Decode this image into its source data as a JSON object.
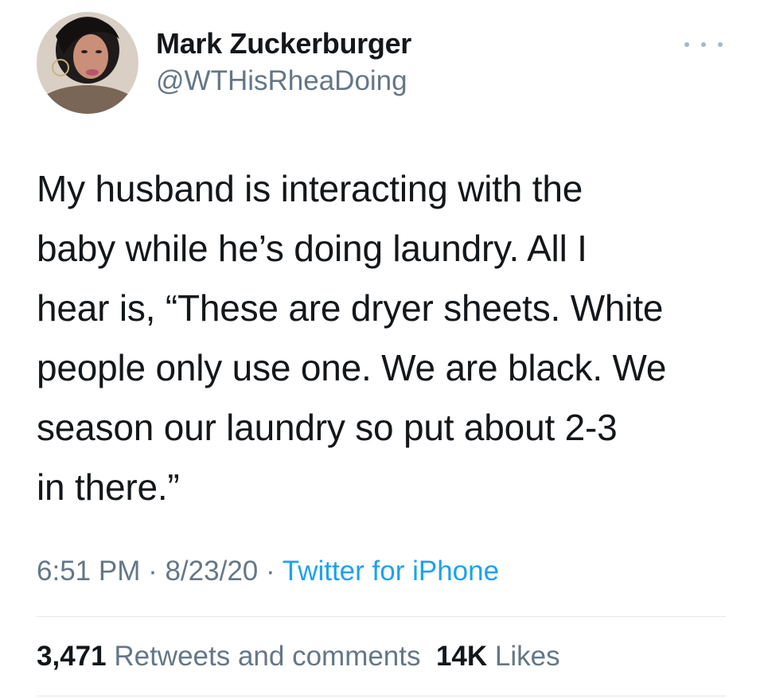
{
  "author": {
    "name": "Mark Zuckerburger",
    "handle": "@WTHisRheaDoing"
  },
  "tweet": {
    "lines": [
      "My husband is interacting with the",
      "baby while he’s doing laundry. All I",
      "hear is, “These are dryer sheets. White",
      "people only use one. We are black. We",
      "season our laundry so put about 2-3",
      "in there.”"
    ]
  },
  "meta": {
    "time": "6:51 PM",
    "separator": " · ",
    "date": "8/23/20",
    "source": "Twitter for iPhone"
  },
  "stats": {
    "retweets_count": "3,471",
    "retweets_label": "Retweets and comments",
    "likes_count": "14K",
    "likes_label": "Likes"
  },
  "icons": {
    "more": "more-horizontal-icon"
  },
  "colors": {
    "text": "#14171a",
    "secondary": "#657786",
    "link": "#1da1f2",
    "divider": "#e1e8ed"
  }
}
